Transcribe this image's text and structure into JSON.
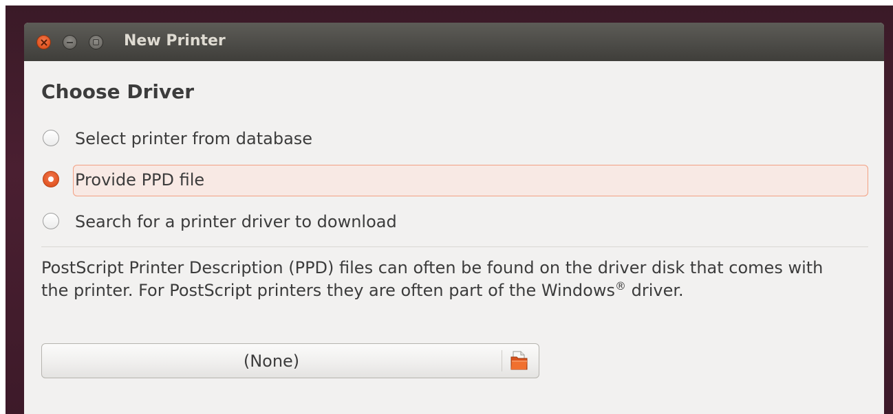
{
  "window": {
    "title": "New Printer",
    "controls": [
      "close-icon",
      "minimize-icon",
      "maximize-icon"
    ]
  },
  "heading": "Choose Driver",
  "options": [
    {
      "label": "Select printer from database",
      "checked": false
    },
    {
      "label": "Provide PPD file",
      "checked": true
    },
    {
      "label": "Search for a printer driver to download",
      "checked": false
    }
  ],
  "description": {
    "text": "PostScript Printer Description (PPD) files can often be found on the driver disk that comes with the printer. For PostScript printers they are often part of the Windows",
    "sup": "®",
    "tail": " driver."
  },
  "file_chooser": {
    "value": "(None)",
    "icon": "folder-open-icon"
  },
  "colors": {
    "accent": "#e0531f",
    "titlebar": "#4b4a46",
    "background": "#f2f1f0"
  }
}
